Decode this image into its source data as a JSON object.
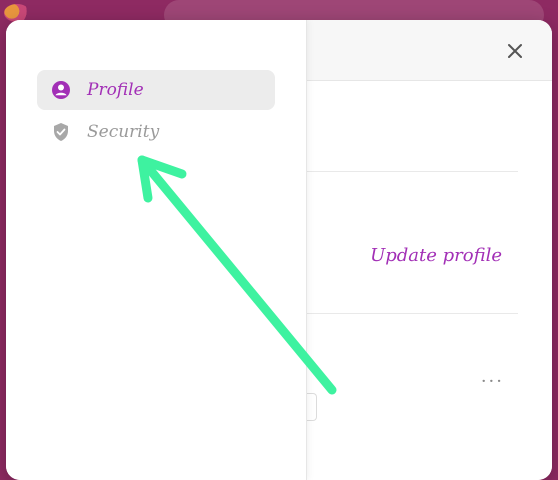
{
  "sidebar": {
    "items": [
      {
        "label": "Profile",
        "icon": "user-circle-icon",
        "active": true
      },
      {
        "label": "Security",
        "icon": "shield-check-icon",
        "active": false
      }
    ]
  },
  "content": {
    "update_profile_label": "Update profile",
    "more_label": "···"
  },
  "colors": {
    "accent": "#a22fb6",
    "background": "#8e2a62",
    "annotation_arrow": "#3ef2a0"
  }
}
